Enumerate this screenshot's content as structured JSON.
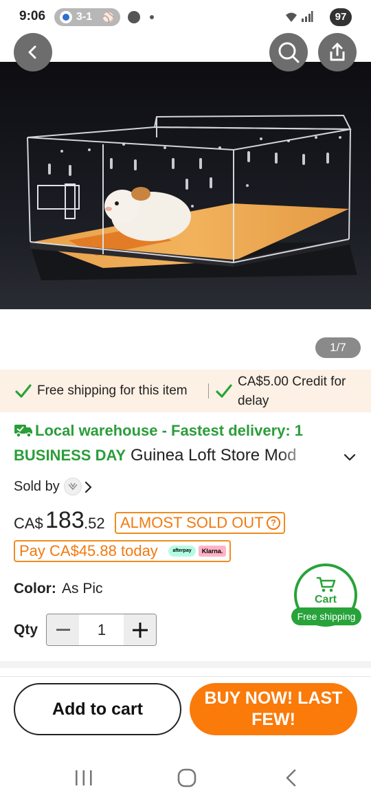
{
  "status_bar": {
    "time": "9:06",
    "score": "3-1",
    "battery": "97"
  },
  "header": {
    "back_icon": "chevron-left-icon",
    "search_icon": "search-icon",
    "share_icon": "share-icon"
  },
  "gallery": {
    "counter": "1/7"
  },
  "shipping": {
    "free_shipping": "Free shipping for this item",
    "credit": "CA$5.00 Credit for delay"
  },
  "product": {
    "warehouse_line1": "Local warehouse - Fastest delivery: 1",
    "warehouse_line2": "BUSINESS DAY",
    "title": "Guinea Loft Store Mod",
    "sold_by_label": "Sold by",
    "price_currency": "CA$",
    "price_main": "183",
    "price_cents": ".52",
    "stock_badge": "ALMOST SOLD OUT",
    "pay_today": "Pay CA$45.88 today",
    "afterpay_label": "afterpay",
    "klarna_label": "Klarna.",
    "color_label": "Color:",
    "color_value": "As Pic",
    "qty_label": "Qty",
    "qty_value": "1"
  },
  "cart_fab": {
    "label": "Cart",
    "shipping": "Free shipping"
  },
  "actions": {
    "add_to_cart": "Add to cart",
    "buy_now": "BUY NOW! LAST FEW!"
  },
  "colors": {
    "accent_orange": "#fa7a0a",
    "success_green": "#27a33a",
    "banner_bg": "#fdf0e4"
  }
}
